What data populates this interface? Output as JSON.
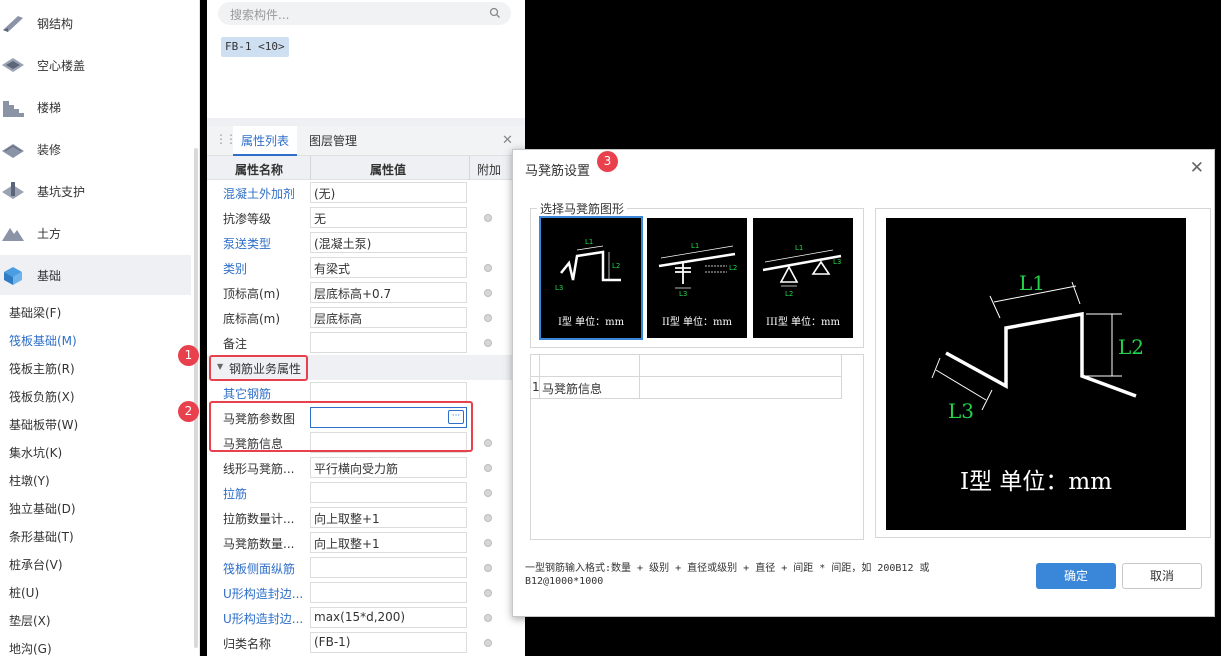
{
  "nav": {
    "categories": [
      {
        "label": "钢结构",
        "icon": "steel-structure-icon"
      },
      {
        "label": "空心楼盖",
        "icon": "hollow-floor-icon"
      },
      {
        "label": "楼梯",
        "icon": "stairs-icon"
      },
      {
        "label": "装修",
        "icon": "decoration-icon"
      },
      {
        "label": "基坑支护",
        "icon": "pit-support-icon"
      },
      {
        "label": "土方",
        "icon": "earthwork-icon"
      },
      {
        "label": "基础",
        "icon": "foundation-icon",
        "active": true
      }
    ],
    "items": [
      {
        "label": "基础梁(F)"
      },
      {
        "label": "筏板基础(M)",
        "active": true
      },
      {
        "label": "筏板主筋(R)"
      },
      {
        "label": "筏板负筋(X)"
      },
      {
        "label": "基础板带(W)"
      },
      {
        "label": "集水坑(K)"
      },
      {
        "label": "柱墩(Y)"
      },
      {
        "label": "独立基础(D)"
      },
      {
        "label": "条形基础(T)"
      },
      {
        "label": "桩承台(V)"
      },
      {
        "label": "桩(U)"
      },
      {
        "label": "垫层(X)"
      },
      {
        "label": "地沟(G)"
      }
    ]
  },
  "component": {
    "search_placeholder": "搜索构件...",
    "selected_tag": "FB-1 <10>"
  },
  "props": {
    "tabs": [
      "属性列表",
      "图层管理"
    ],
    "columns": [
      "属性名称",
      "属性值",
      "附加"
    ],
    "rows": [
      {
        "name": "混凝土外加剂",
        "value": "(无)",
        "blue": true
      },
      {
        "name": "抗渗等级",
        "value": "无",
        "dot": true
      },
      {
        "name": "泵送类型",
        "value": "(混凝土泵)",
        "blue": true
      },
      {
        "name": "类别",
        "value": "有梁式",
        "blue": true,
        "dot": true
      },
      {
        "name": "顶标高(m)",
        "value": "层底标高+0.7",
        "dot": true
      },
      {
        "name": "底标高(m)",
        "value": "层底标高",
        "dot": true
      },
      {
        "name": "备注",
        "value": "",
        "dot": true
      }
    ],
    "section_label": "钢筋业务属性",
    "section_rows": [
      {
        "name": "其它钢筋",
        "value": "",
        "blue": true
      },
      {
        "name": "马凳筋参数图",
        "value": "",
        "focused": true
      },
      {
        "name": "马凳筋信息",
        "value": "",
        "dot": true
      },
      {
        "name": "线形马凳筋...",
        "value": "平行横向受力筋",
        "dot": true
      },
      {
        "name": "拉筋",
        "value": "",
        "blue": true,
        "dot": true
      },
      {
        "name": "拉筋数量计...",
        "value": "向上取整+1",
        "dot": true
      },
      {
        "name": "马凳筋数量...",
        "value": "向上取整+1",
        "dot": true
      },
      {
        "name": "筏板侧面纵筋",
        "value": "",
        "blue": true,
        "dot": true
      },
      {
        "name": "U形构造封边...",
        "value": "",
        "blue": true,
        "dot": true
      },
      {
        "name": "U形构造封边...",
        "value": "max(15*d,200)",
        "blue": true,
        "dot": true
      },
      {
        "name": "归类名称",
        "value": "(FB-1)",
        "dot": true
      }
    ]
  },
  "callouts": [
    "1",
    "2",
    "3"
  ],
  "dialog": {
    "title": "马凳筋设置",
    "group_label": "选择马凳筋图形",
    "shapes": [
      {
        "caption": "I型 单位：mm",
        "selected": true
      },
      {
        "caption": "II型 单位：mm"
      },
      {
        "caption": "III型 单位：mm"
      }
    ],
    "table_row_num": "1",
    "table_row_name": "马凳筋信息",
    "preview": {
      "labels": [
        "L1",
        "L2",
        "L3"
      ],
      "caption": "I型 单位：mm"
    },
    "hint": "一型钢筋输入格式:数量 + 级别 + 直径或级别 + 直径 + 间距 * 间距，如 200B12 或 B12@1000*1000",
    "ok_label": "确定",
    "cancel_label": "取消"
  },
  "colors": {
    "accent": "#2f6fc9",
    "callout": "#e8414d",
    "dim_green": "#21d44a"
  }
}
